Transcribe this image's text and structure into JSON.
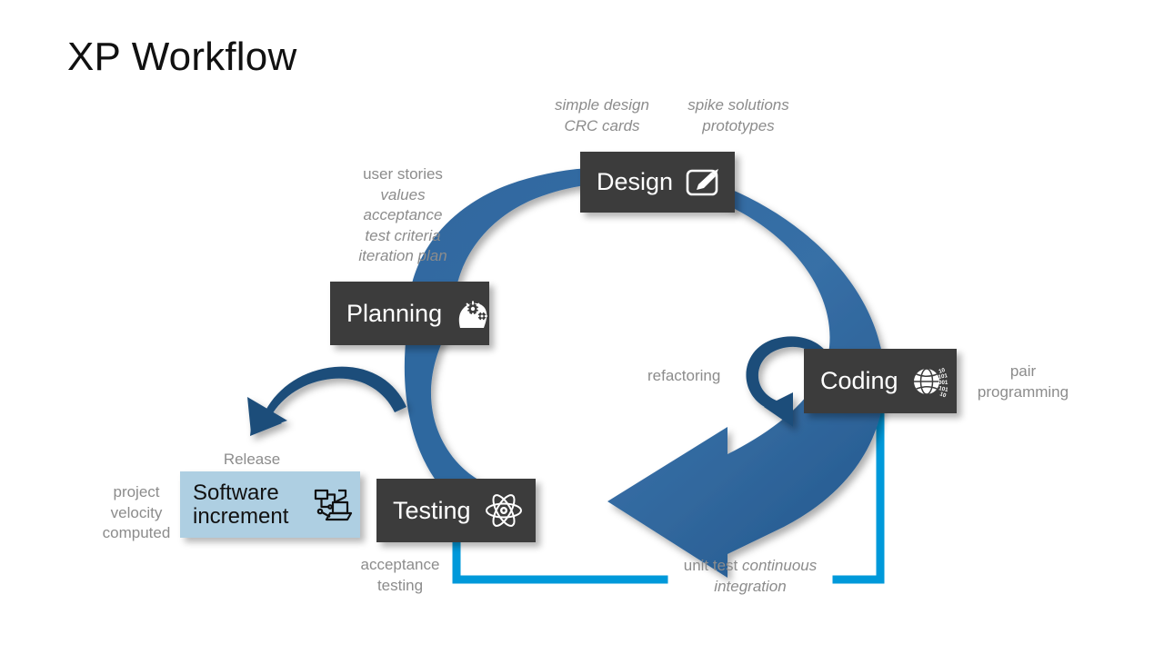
{
  "page": {
    "title": "XP Workflow",
    "background": "#ffffff"
  },
  "colors": {
    "ring_blue": "#2f679f",
    "arrow_dark_blue": "#1f4e7a",
    "cyan_line": "#0099da",
    "box_dark": "#3c3c3c",
    "box_light_blue": "#aecfe2",
    "note_gray": "#8c8c8c",
    "title_black": "#111111"
  },
  "stages": [
    {
      "id": "design",
      "label": "Design",
      "icon": "paintbrush-icon"
    },
    {
      "id": "planning",
      "label": "Planning",
      "icon": "head-gears-icon"
    },
    {
      "id": "coding",
      "label": "Coding",
      "icon": "globe-binary-icon"
    },
    {
      "id": "testing",
      "label": "Testing",
      "icon": "atom-icon"
    }
  ],
  "increment": {
    "label": "Software\nincrement",
    "icon": "computer-network-icon"
  },
  "notes": {
    "simple_design_line1": "simple design",
    "simple_design_line2": "CRC cards",
    "spike_line1": "spike solutions",
    "spike_line2": "prototypes",
    "planning_line1": "user stories",
    "planning_line2": "values",
    "planning_line3": "acceptance",
    "planning_line4": "test criteria",
    "planning_line5": "iteration plan",
    "refactoring": "refactoring",
    "pair_line1": "pair",
    "pair_line2": "programming",
    "release": "Release",
    "project_line1": "project",
    "project_line2": "velocity",
    "project_line3": "computed",
    "acceptance_line1": "acceptance",
    "acceptance_line2": "testing",
    "unittest_plain": "unit test ",
    "unittest_italic1": "continuous",
    "unittest_italic2": "integration"
  }
}
